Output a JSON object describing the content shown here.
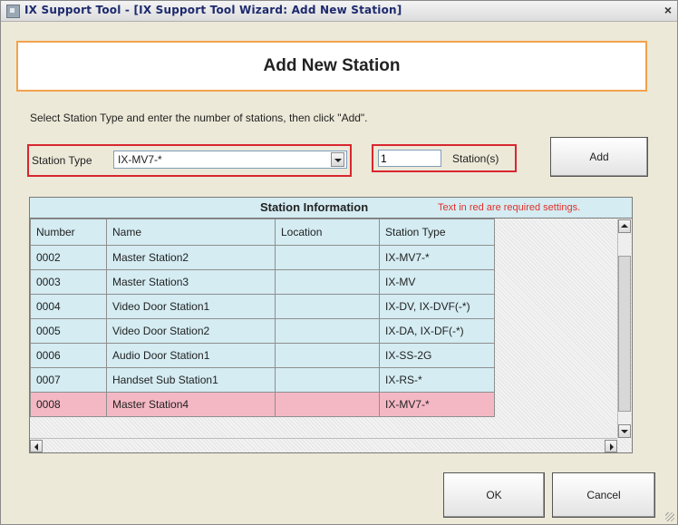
{
  "window": {
    "title": "IX Support Tool - [IX Support Tool Wizard: Add New Station]",
    "close_glyph": "×"
  },
  "header": {
    "title": "Add New Station"
  },
  "instruction": "Select Station Type and enter the number of stations, then click \"Add\".",
  "station_type": {
    "label": "Station Type",
    "selected": "IX-MV7-*"
  },
  "station_count": {
    "value": "1",
    "label": "Station(s)"
  },
  "buttons": {
    "add": "Add",
    "ok": "OK",
    "cancel": "Cancel"
  },
  "station_info": {
    "title": "Station Information",
    "note": "Text in red are required settings.",
    "columns": [
      "Number",
      "Name",
      "Location",
      "Station Type"
    ],
    "rows": [
      {
        "number": "0002",
        "name": "Master Station2",
        "location": "",
        "type": "IX-MV7-*",
        "selected": false
      },
      {
        "number": "0003",
        "name": "Master Station3",
        "location": "",
        "type": "IX-MV",
        "selected": false
      },
      {
        "number": "0004",
        "name": "Video Door Station1",
        "location": "",
        "type": "IX-DV, IX-DVF(-*)",
        "selected": false
      },
      {
        "number": "0005",
        "name": "Video Door Station2",
        "location": "",
        "type": "IX-DA, IX-DF(-*)",
        "selected": false
      },
      {
        "number": "0006",
        "name": "Audio Door Station1",
        "location": "",
        "type": "IX-SS-2G",
        "selected": false
      },
      {
        "number": "0007",
        "name": "Handset Sub Station1",
        "location": "",
        "type": "IX-RS-*",
        "selected": false
      },
      {
        "number": "0008",
        "name": "Master Station4",
        "location": "",
        "type": "IX-MV7-*",
        "selected": true
      }
    ]
  },
  "colors": {
    "required_border": "#d8262e",
    "header_border": "#f2a24c",
    "table_bg": "#d4ecf2",
    "selected_row": "#f4b8c4",
    "note_text": "#e0302b"
  }
}
